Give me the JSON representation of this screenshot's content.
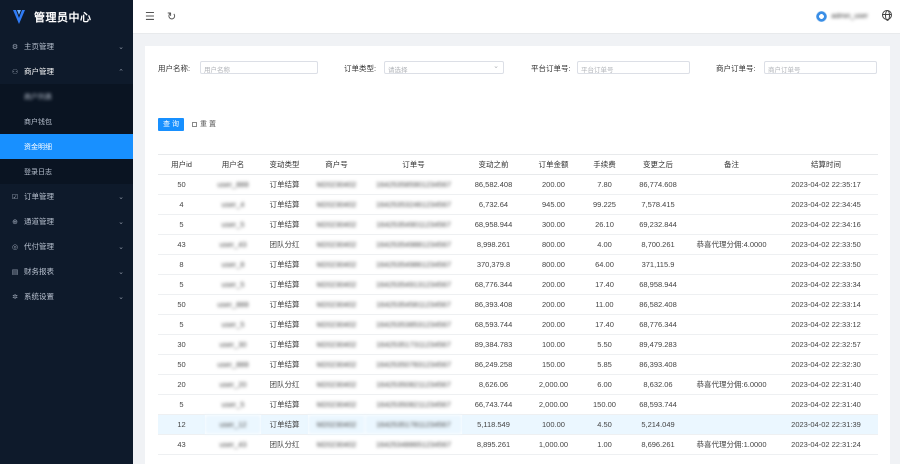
{
  "app": {
    "title": "管理员中心"
  },
  "sidebar": {
    "items": [
      {
        "icon": "settings-icon",
        "label": "主页管理"
      },
      {
        "icon": "user-icon",
        "label": "商户管理",
        "open": true
      },
      {
        "icon": "order-icon",
        "label": "订单管理"
      },
      {
        "icon": "channel-icon",
        "label": "通道管理"
      },
      {
        "icon": "payment-icon",
        "label": "代付管理"
      },
      {
        "icon": "report-icon",
        "label": "财务报表"
      },
      {
        "icon": "gear-icon",
        "label": "系统设置"
      }
    ],
    "subitems": [
      "商户列表",
      "商户钱包",
      "资金明细",
      "登录日志"
    ],
    "active_sub": "资金明细"
  },
  "header": {
    "user_name": "admin_user"
  },
  "filters": [
    {
      "label": "用户名称:",
      "placeholder": "用户名称"
    },
    {
      "label": "订单类型:",
      "placeholder": "请选择"
    },
    {
      "label": "平台订单号:",
      "placeholder": "平台订单号"
    },
    {
      "label": "商户订单号:",
      "placeholder": "商户订单号"
    }
  ],
  "buttons": {
    "search": "查 询",
    "reset": "重 置"
  },
  "table": {
    "columns": [
      "用户id",
      "用户名",
      "变动类型",
      "商户号",
      "订单号",
      "变动之前",
      "订单金额",
      "手续费",
      "变更之后",
      "备注",
      "结算时间"
    ],
    "rows": [
      [
        "50",
        "user_888",
        "订单结算",
        "M20230402",
        "164253585901234567",
        "86,582.408",
        "200.00",
        "7.80",
        "86,774.608",
        "",
        "2023-04-02 22:35:17"
      ],
      [
        "4",
        "user_4",
        "订单结算",
        "M20230402",
        "164253532461234567",
        "6,732.64",
        "945.00",
        "99.225",
        "7,578.415",
        "",
        "2023-04-02 22:34:45"
      ],
      [
        "5",
        "user_5",
        "订单结算",
        "M20230402",
        "164253549011234567",
        "68,958.944",
        "300.00",
        "26.10",
        "69,232.844",
        "",
        "2023-04-02 22:34:16"
      ],
      [
        "43",
        "user_43",
        "团队分红",
        "M20230402",
        "164253549881234567",
        "8,998.261",
        "800.00",
        "4.00",
        "8,700.261",
        "恭喜代理分佣:4.0000",
        "2023-04-02 22:33:50"
      ],
      [
        "8",
        "user_8",
        "订单结算",
        "M20230402",
        "164253549861234567",
        "370,379.8",
        "800.00",
        "64.00",
        "371,115.9",
        "",
        "2023-04-02 22:33:50"
      ],
      [
        "5",
        "user_5",
        "订单结算",
        "M20230402",
        "164253549131234567",
        "68,776.344",
        "200.00",
        "17.40",
        "68,958.944",
        "",
        "2023-04-02 22:33:34"
      ],
      [
        "50",
        "user_888",
        "订单结算",
        "M20230402",
        "164253545811234567",
        "86,393.408",
        "200.00",
        "11.00",
        "86,582.408",
        "",
        "2023-04-02 22:33:14"
      ],
      [
        "5",
        "user_5",
        "订单结算",
        "M20230402",
        "164253538531234567",
        "68,593.744",
        "200.00",
        "17.40",
        "68,776.344",
        "",
        "2023-04-02 22:33:12"
      ],
      [
        "30",
        "user_30",
        "订单结算",
        "M20230402",
        "164253517311234567",
        "89,384.783",
        "100.00",
        "5.50",
        "89,479.283",
        "",
        "2023-04-02 22:32:57"
      ],
      [
        "50",
        "user_888",
        "订单结算",
        "M20230402",
        "164253507831234567",
        "86,249.258",
        "150.00",
        "5.85",
        "86,393.408",
        "",
        "2023-04-02 22:32:30"
      ],
      [
        "20",
        "user_20",
        "团队分红",
        "M20230402",
        "164253508211234567",
        "8,626.06",
        "2,000.00",
        "6.00",
        "8,632.06",
        "恭喜代理分佣:6.0000",
        "2023-04-02 22:31:40"
      ],
      [
        "5",
        "user_5",
        "订单结算",
        "M20230402",
        "164253508211234567",
        "66,743.744",
        "2,000.00",
        "150.00",
        "68,593.744",
        "",
        "2023-04-02 22:31:40"
      ],
      [
        "12",
        "user_12",
        "订单结算",
        "M20230402",
        "164253517811234567",
        "5,118.549",
        "100.00",
        "4.50",
        "5,214.049",
        "",
        "2023-04-02 22:31:39"
      ],
      [
        "43",
        "user_43",
        "团队分红",
        "M20230402",
        "164253488651234567",
        "8,895.261",
        "1,000.00",
        "1.00",
        "8,696.261",
        "恭喜代理分佣:1.0000",
        "2023-04-02 22:31:24"
      ]
    ]
  }
}
